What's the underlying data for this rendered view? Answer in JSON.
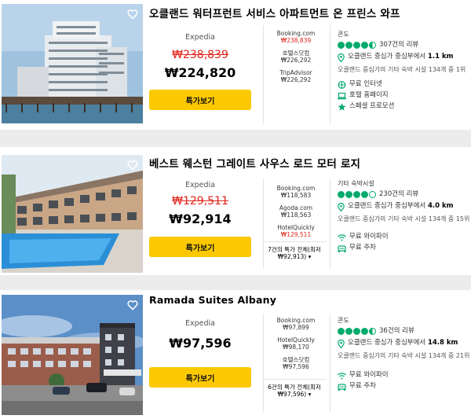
{
  "hotels": [
    {
      "name": "오클랜드 워터프런트 서비스 아파트먼트 온 프린스 와프",
      "provider": "Expedia",
      "old_price": "₩238,839",
      "price": "₩224,820",
      "deal_label": "특가보기",
      "offers": [
        {
          "site": "Booking.com",
          "amount": "₩238,839",
          "highlight": true
        },
        {
          "site": "호텔스닷컴",
          "amount": "₩226,292",
          "highlight": false
        },
        {
          "site": "TripAdvisor",
          "amount": "₩226,292",
          "highlight": false
        }
      ],
      "category": "콘도",
      "rating": 4.5,
      "reviews": "307건의 리뷰",
      "distance_prefix": "오클랜드 중심가 중심부에서 ",
      "distance_value": "1.1 km",
      "rank": "오클랜드 중심가의 기타 숙박 시설 134개 중 1위",
      "amenities": [
        {
          "icon": "wifi-icon",
          "label": "무료 인터넷"
        },
        {
          "icon": "laptop-icon",
          "label": "호텔 홈페이지"
        },
        {
          "icon": "star-icon",
          "label": "스페셜 프로모션"
        }
      ]
    },
    {
      "name": "베스트 웨스턴 그레이트 사우스 로드 모터 로지",
      "provider": "Expedia",
      "old_price": "₩129,511",
      "price": "₩92,914",
      "deal_label": "특가보기",
      "offers": [
        {
          "site": "Booking.com",
          "amount": "₩118,583",
          "highlight": false
        },
        {
          "site": "Agoda.com",
          "amount": "₩118,563",
          "highlight": false
        },
        {
          "site": "HotelQuickly",
          "amount": "₩129,511",
          "highlight": true
        }
      ],
      "more_deals_line1": "7건의 특가 전체(최저",
      "more_deals_line2": "₩92,913)",
      "category": "기타 숙박시설",
      "rating": 4,
      "reviews": "230건의 리뷰",
      "distance_prefix": "오클랜드 중심가 중심부에서 ",
      "distance_value": "4.0 km",
      "rank": "오클랜드 중심가의 기타 숙박 시설 134개 중 15위",
      "amenities": [
        {
          "icon": "wifi-icon",
          "label": "무료 와이파이"
        },
        {
          "icon": "car-icon",
          "label": "무료 주차"
        }
      ]
    },
    {
      "name": "Ramada Suites Albany",
      "provider": "Expedia",
      "old_price": "",
      "price": "₩97,596",
      "deal_label": "특가보기",
      "offers": [
        {
          "site": "Booking.com",
          "amount": "₩97,899",
          "highlight": false
        },
        {
          "site": "HotelQuickly",
          "amount": "₩98,170",
          "highlight": false
        },
        {
          "site": "호텔스닷컴",
          "amount": "₩97,596",
          "highlight": false
        }
      ],
      "more_deals_line1": "6건의 특가 전체(최저",
      "more_deals_line2": "₩97,596)",
      "category": "콘도",
      "rating": 4.5,
      "reviews": "36건의 리뷰",
      "distance_prefix": "오클랜드 중심가 중심부에서 ",
      "distance_value": "14.8 km",
      "rank": "오클랜드 중심가의 기타 숙박 시설 134개 중 21위",
      "amenities": [
        {
          "icon": "wifi-icon",
          "label": "무료 와이파이"
        },
        {
          "icon": "car-icon",
          "label": "무료 주차"
        }
      ]
    }
  ],
  "colors": {
    "deal_button": "#fcc900",
    "strike_price": "#e2231a",
    "rating_bubble": "#00aa6c"
  }
}
